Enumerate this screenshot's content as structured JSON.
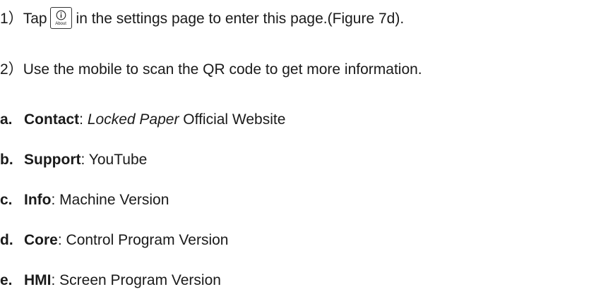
{
  "steps": [
    {
      "number": "1）",
      "before": "Tap",
      "icon": "info-icon",
      "icon_label": "About",
      "after": "in the settings page to enter this page.(Figure 7d)."
    },
    {
      "number": "2）",
      "text": "Use the mobile to scan the QR code to get more information."
    }
  ],
  "items": [
    {
      "letter": "a.",
      "term": "Contact",
      "sep": ":",
      "italic": "Locked Paper",
      "rest": " Official Website"
    },
    {
      "letter": "b.",
      "term": "Support",
      "sep": ":",
      "rest": " YouTube"
    },
    {
      "letter": "c.",
      "term": "Info",
      "sep": ":",
      "rest": " Machine Version"
    },
    {
      "letter": "d.",
      "term": "Core",
      "sep": ":",
      "rest": " Control Program Version"
    },
    {
      "letter": "e.",
      "term": "HMI",
      "sep": ":",
      "rest": " Screen Program Version"
    }
  ]
}
